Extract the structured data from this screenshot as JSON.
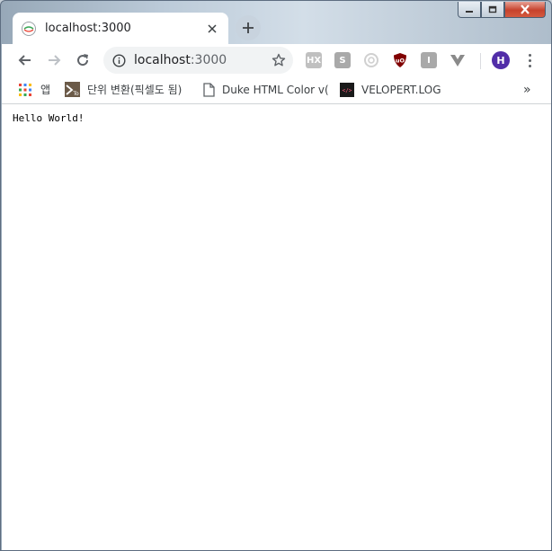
{
  "window": {
    "controls": {
      "minimize": "minimize",
      "maximize": "maximize",
      "close": "close"
    }
  },
  "tab": {
    "title": "localhost:3000",
    "close_icon": "close-icon",
    "new_tab_icon": "plus-icon"
  },
  "toolbar": {
    "url_host": "localhost",
    "url_port": ":3000",
    "extensions": [
      {
        "name": "extension-hx",
        "text": "HX",
        "color": "#c0c0c0"
      },
      {
        "name": "extension-s",
        "text": "S",
        "color": "#a9a9a9"
      },
      {
        "name": "extension-circle",
        "text": "",
        "color": "#d6d6d6"
      },
      {
        "name": "extension-ublock",
        "text": "uO",
        "color": "#800000"
      },
      {
        "name": "extension-i",
        "text": "I",
        "color": "#a9a9a9"
      },
      {
        "name": "extension-vue",
        "text": "",
        "color": "#808080"
      }
    ],
    "profile_initial": "H",
    "profile_color": "#512da8"
  },
  "bookmarks": {
    "apps_label": "앱",
    "items": [
      {
        "label": "단위 변환(픽셀도 됨)"
      },
      {
        "label": "Duke HTML Color v("
      },
      {
        "label": "VELOPERT.LOG"
      }
    ],
    "overflow": "»"
  },
  "page": {
    "body_text": "Hello World!"
  }
}
